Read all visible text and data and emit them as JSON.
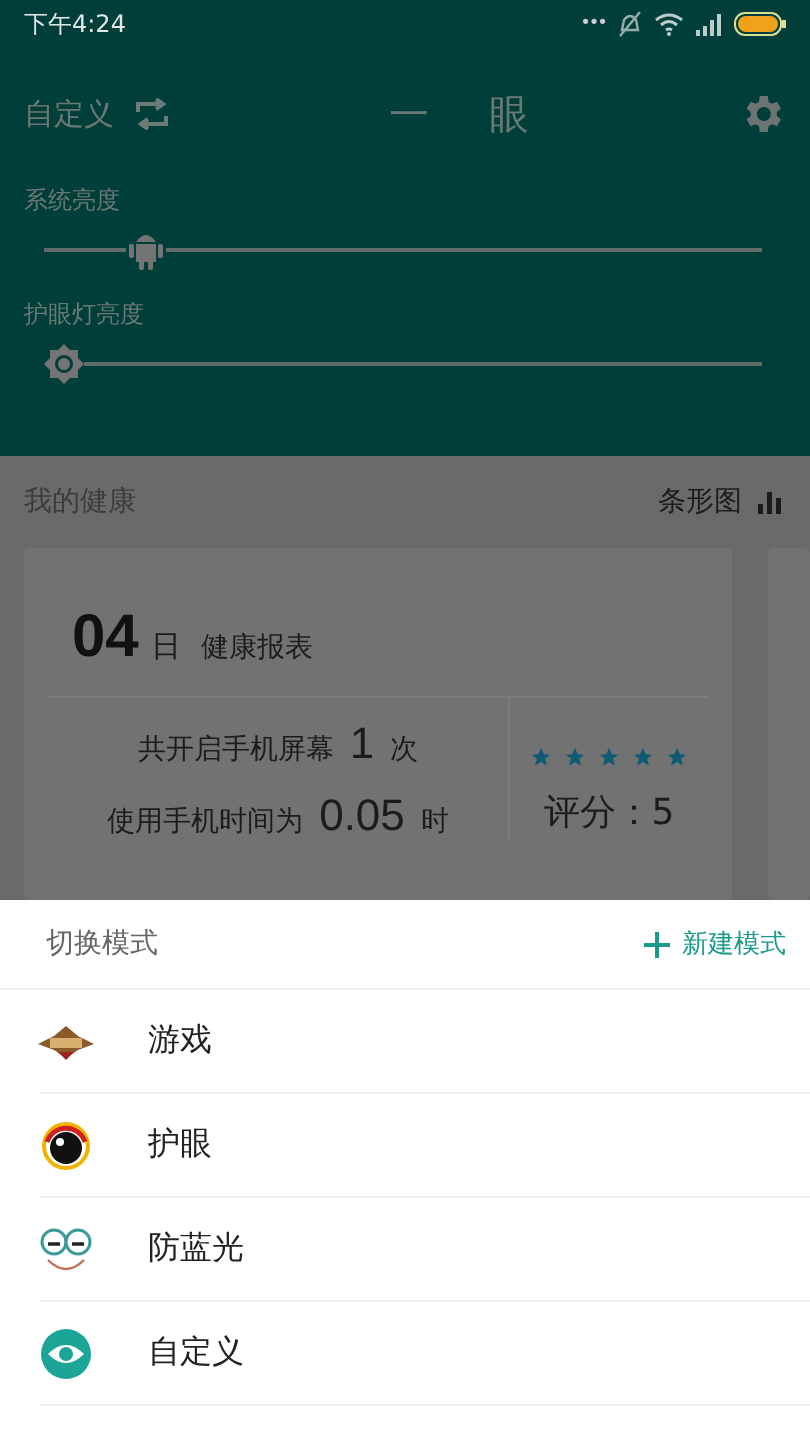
{
  "status_bar": {
    "time": "下午4:24",
    "dots": "•••"
  },
  "header": {
    "mode_label": "自定义",
    "title": "一 眼"
  },
  "sliders": [
    {
      "label": "系统亮度",
      "kind": "android",
      "level": 0.12
    },
    {
      "label": "护眼灯亮度",
      "kind": "sun",
      "level": 0.0
    }
  ],
  "health": {
    "title": "我的健康",
    "chart_toggle": "条形图",
    "card": {
      "day": "04",
      "day_unit": "日",
      "title": "健康报表",
      "stats": [
        {
          "prefix": "共开启手机屏幕",
          "value": "1",
          "unit": "次"
        },
        {
          "prefix": "使用手机时间为",
          "value": "0.05",
          "unit": "时"
        }
      ],
      "stars": 5,
      "score": "评分：5"
    }
  },
  "sheet": {
    "title": "切换模式",
    "new_button": "新建模式",
    "modes": [
      {
        "label": "游戏",
        "kind": "game"
      },
      {
        "label": "护眼",
        "kind": "eye"
      },
      {
        "label": "防蓝光",
        "kind": "glasses"
      },
      {
        "label": "自定义",
        "kind": "custom"
      }
    ]
  }
}
